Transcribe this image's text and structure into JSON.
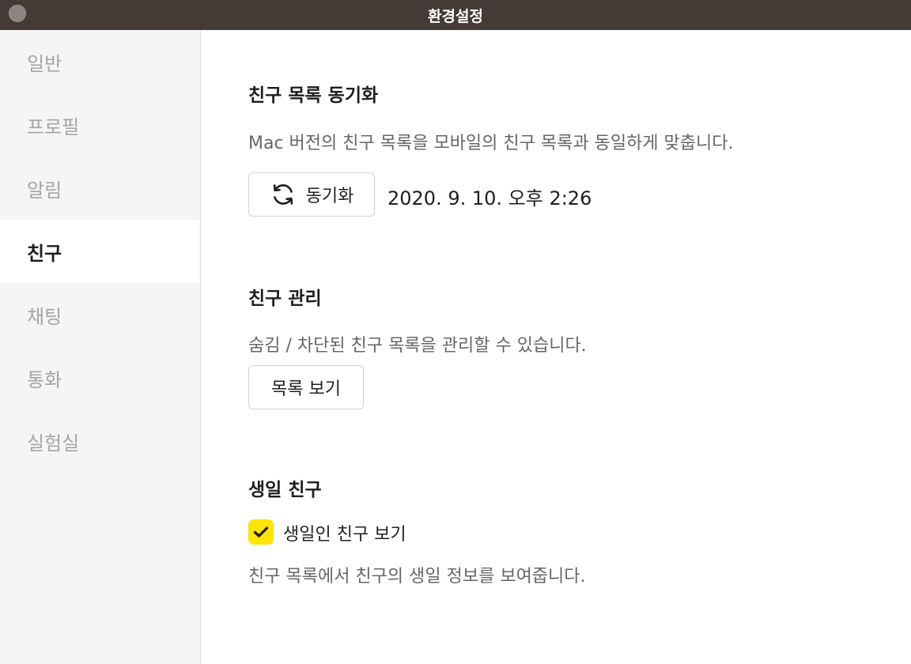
{
  "window": {
    "title": "환경설정"
  },
  "sidebar": {
    "items": [
      {
        "label": "일반"
      },
      {
        "label": "프로필"
      },
      {
        "label": "알림"
      },
      {
        "label": "친구",
        "active": true
      },
      {
        "label": "채팅"
      },
      {
        "label": "통화"
      },
      {
        "label": "실험실"
      }
    ]
  },
  "sync": {
    "title": "친구 목록 동기화",
    "description": "Mac 버전의 친구 목록을 모바일의 친구 목록과 동일하게 맞춥니다.",
    "button_label": "동기화",
    "button_icon": "refresh-icon",
    "last_synced": "2020. 9. 10. 오후 2:26"
  },
  "manage": {
    "title": "친구 관리",
    "description": "숨김 / 차단된 친구 목록을 관리할 수 있습니다.",
    "button_label": "목록 보기"
  },
  "birthday": {
    "title": "생일 친구",
    "checkbox_label": "생일인 친구 보기",
    "checked": true,
    "description": "친구 목록에서 친구의 생일 정보를 보여줍니다."
  },
  "colors": {
    "titlebar": "#453a35",
    "accent": "#fee500"
  }
}
